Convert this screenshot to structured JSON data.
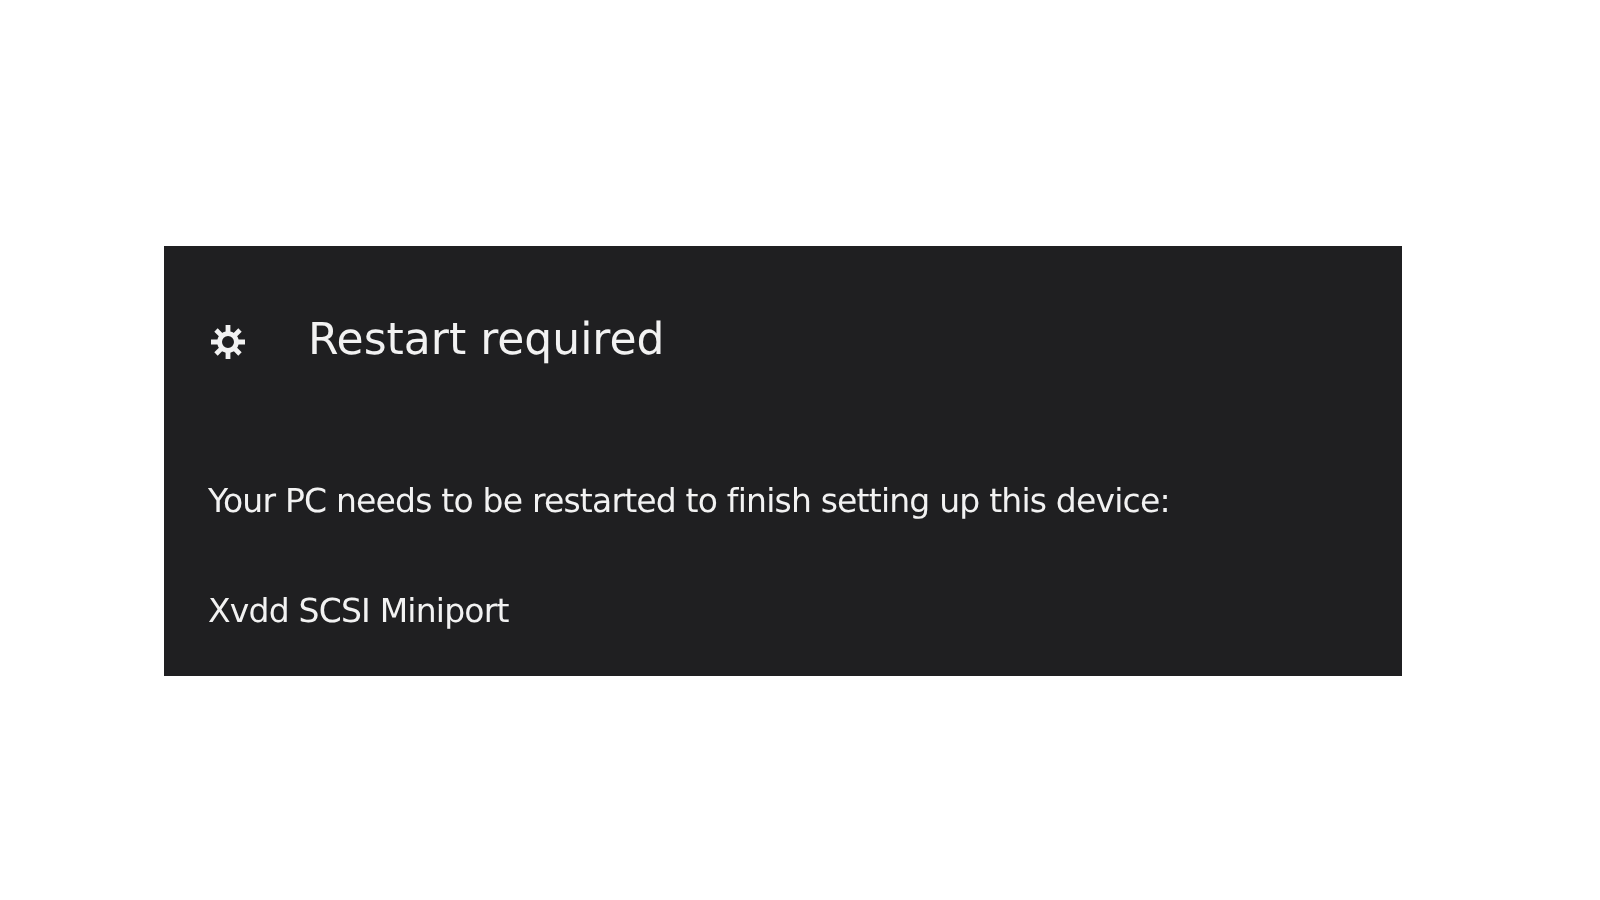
{
  "notification": {
    "title": "Restart required",
    "message": "Your PC needs to be restarted to finish setting up this device:",
    "device": "Xvdd SCSI Miniport"
  }
}
